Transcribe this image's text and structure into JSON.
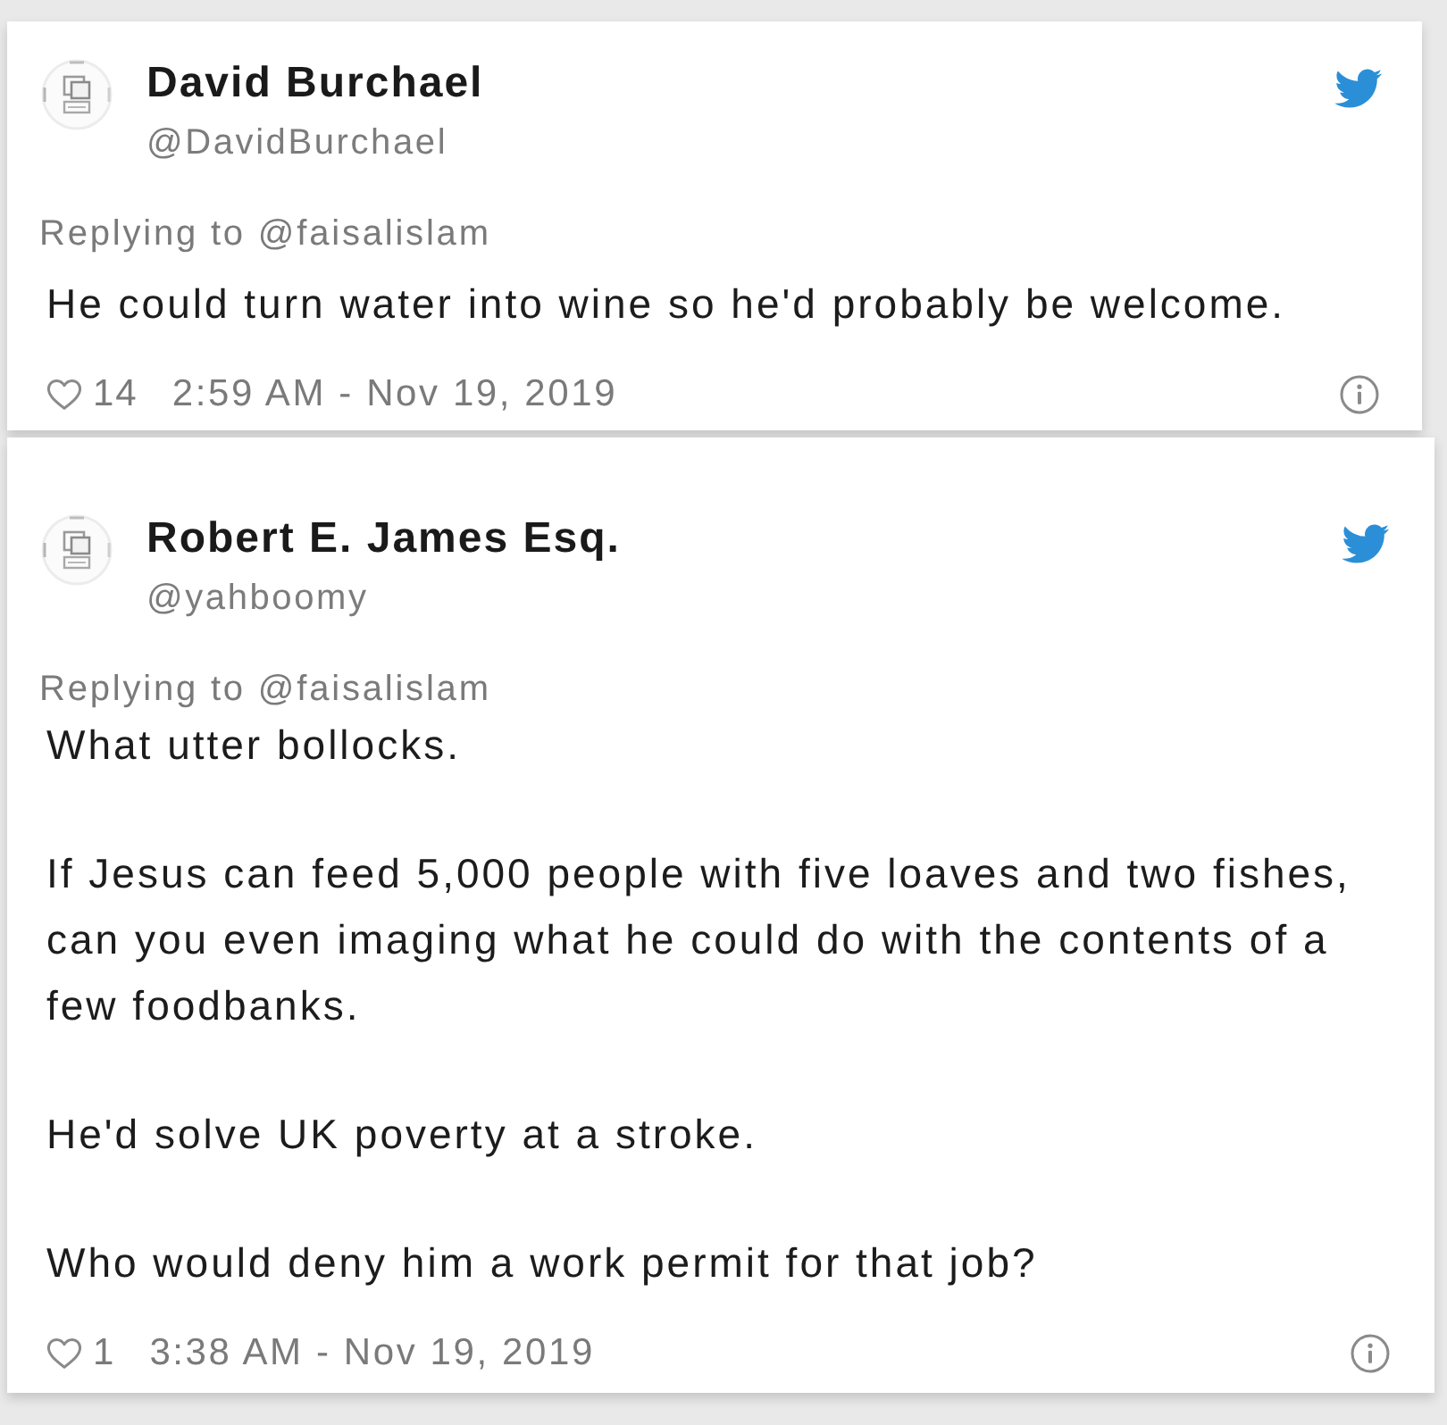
{
  "tweets": [
    {
      "name": "David Burchael",
      "handle": "@DavidBurchael",
      "replying_to": "Replying to @faisalislam",
      "paragraphs": [
        "He could turn water into wine so he'd probably be welcome."
      ],
      "likes": "14",
      "timestamp": "2:59 AM - Nov 19, 2019"
    },
    {
      "name": "Robert E. James Esq.",
      "handle": "@yahboomy",
      "replying_to": "Replying to @faisalislam",
      "paragraphs": [
        "What utter bollocks.",
        "If Jesus can feed 5,000 people with five loaves and two fishes, can you even imaging what he could do with the contents of a few foodbanks.",
        "He'd solve UK poverty at a stroke.",
        "Who would deny him a work permit for that job?"
      ],
      "likes": "1",
      "timestamp": "3:38 AM - Nov 19, 2019"
    }
  ]
}
